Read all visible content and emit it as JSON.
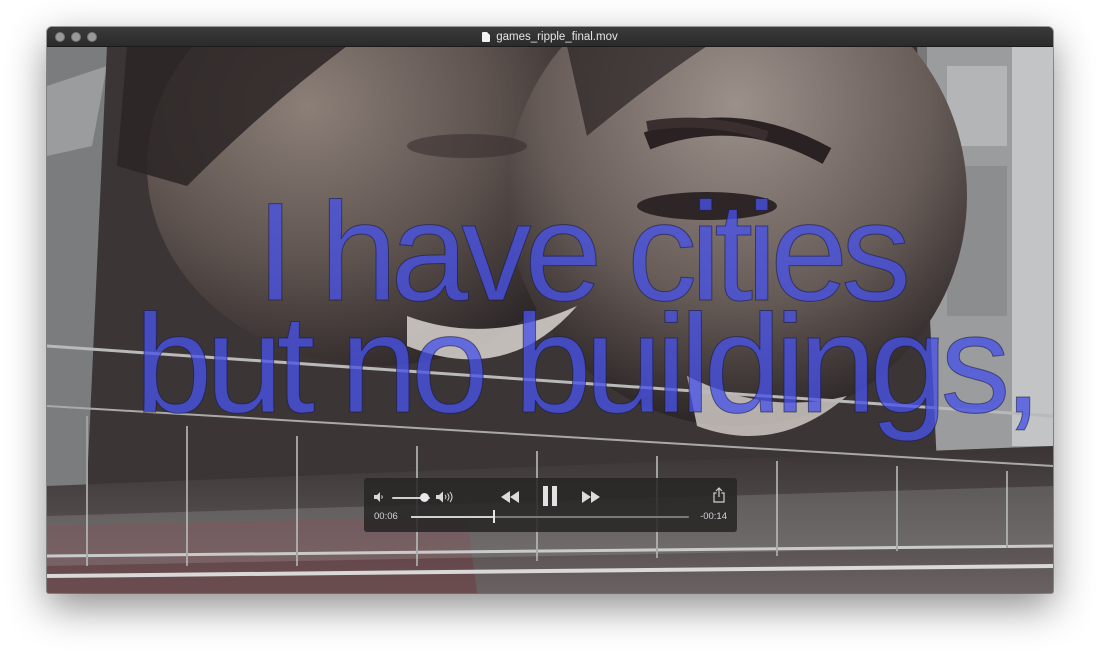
{
  "window": {
    "title": "games_ripple_final.mov"
  },
  "video": {
    "lyrics_line1": "I have cities",
    "lyrics_line2": "but no buildings,",
    "lyric_color": "#4852e6"
  },
  "player": {
    "elapsed": "00:06",
    "remaining": "-00:14",
    "progress_fraction": 0.3,
    "volume_fraction": 0.85,
    "state": "playing",
    "icons": {
      "volume_low": "speaker-low-icon",
      "volume_high": "speaker-high-icon",
      "rewind": "rewind-icon",
      "pause": "pause-icon",
      "fast_forward": "fast-forward-icon",
      "share": "share-icon"
    }
  }
}
